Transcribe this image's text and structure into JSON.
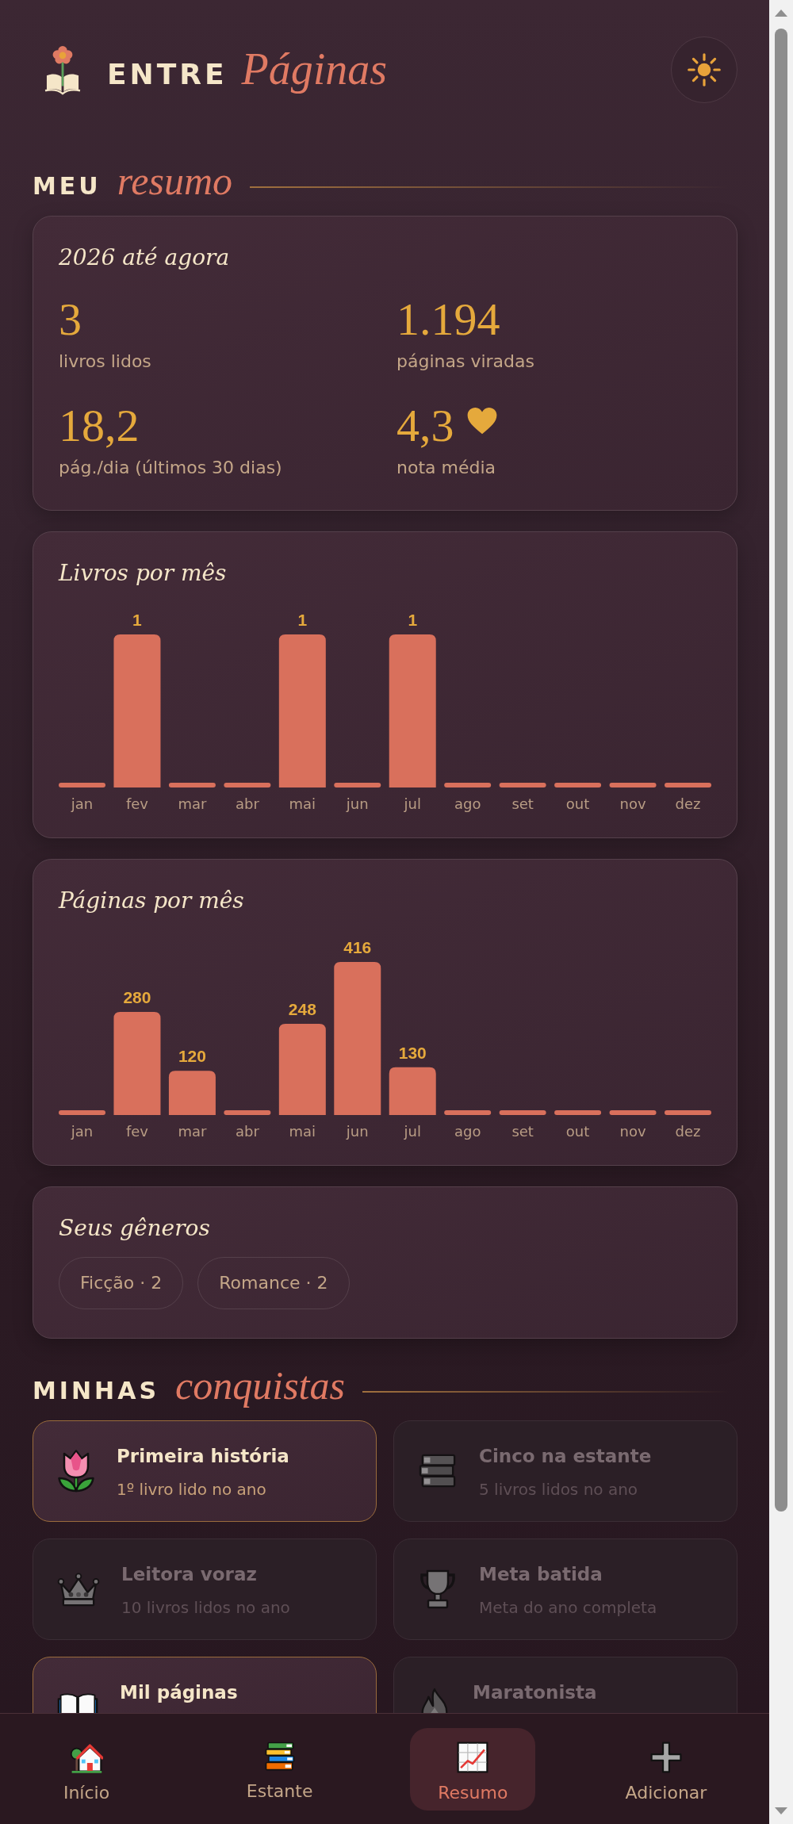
{
  "header": {
    "title": {
      "word": "ENTRE",
      "italic": "Páginas"
    }
  },
  "summary": {
    "heading": {
      "word": "MEU",
      "italic": "resumo"
    },
    "year_card": {
      "title": "2026 até agora",
      "stats": [
        {
          "value": "3",
          "label": "livros lidos",
          "heart": false
        },
        {
          "value": "1.194",
          "label": "páginas viradas",
          "heart": false
        },
        {
          "value": "18,2",
          "label": "pág./dia (últimos 30 dias)",
          "heart": false
        },
        {
          "value": "4,3",
          "label": "nota média",
          "heart": true
        }
      ]
    },
    "charts": [
      {
        "chart_data": {
          "type": "bar",
          "title": "Livros por mês",
          "categories": [
            "jan",
            "fev",
            "mar",
            "abr",
            "mai",
            "jun",
            "jul",
            "ago",
            "set",
            "out",
            "nov",
            "dez"
          ],
          "values": [
            0,
            1,
            0,
            0,
            1,
            0,
            1,
            0,
            0,
            0,
            0,
            0
          ],
          "value_labels": [
            null,
            "1",
            null,
            null,
            "1",
            null,
            "1",
            null,
            null,
            null,
            null,
            null
          ]
        }
      },
      {
        "chart_data": {
          "type": "bar",
          "title": "Páginas por mês",
          "categories": [
            "jan",
            "fev",
            "mar",
            "abr",
            "mai",
            "jun",
            "jul",
            "ago",
            "set",
            "out",
            "nov",
            "dez"
          ],
          "values": [
            0,
            280,
            120,
            0,
            248,
            416,
            130,
            0,
            0,
            0,
            0,
            0
          ],
          "value_labels": [
            null,
            "280",
            "120",
            null,
            "248",
            "416",
            "130",
            null,
            null,
            null,
            null,
            null
          ]
        }
      }
    ],
    "genres": {
      "title": "Seus gêneros",
      "tags": [
        "Ficção · 2",
        "Romance · 2"
      ]
    }
  },
  "achievements": {
    "heading": {
      "word": "MINHAS",
      "italic": "conquistas"
    },
    "items": [
      {
        "title": "Primeira história",
        "subtitle": "1º livro lido no ano",
        "unlocked": true
      },
      {
        "title": "Cinco na estante",
        "subtitle": "5 livros lidos no ano",
        "unlocked": false
      },
      {
        "title": "Leitora voraz",
        "subtitle": "10 livros lidos no ano",
        "unlocked": false
      },
      {
        "title": "Meta batida",
        "subtitle": "Meta do ano completa",
        "unlocked": false
      },
      {
        "title": "Mil páginas",
        "unlocked": true
      },
      {
        "title": "Maratonista",
        "unlocked": false
      }
    ]
  },
  "nav": {
    "items": [
      {
        "label": "Início",
        "selected": false
      },
      {
        "label": "Estante",
        "selected": false
      },
      {
        "label": "Resumo",
        "selected": true
      },
      {
        "label": "Adicionar",
        "selected": false
      }
    ]
  }
}
